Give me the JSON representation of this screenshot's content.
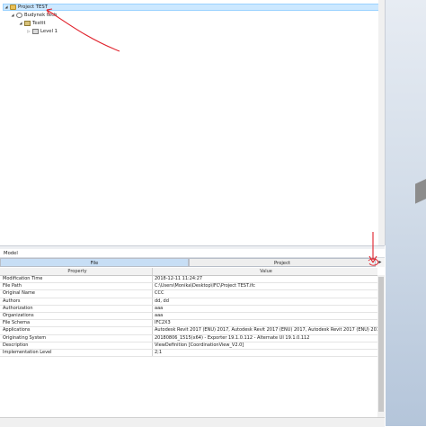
{
  "tree": {
    "items": [
      {
        "label": "Project TEST",
        "toggle": "◢",
        "icon": "folder-icon"
      },
      {
        "label": "Budynek tech",
        "toggle": "◢",
        "icon": "building-icon"
      },
      {
        "label": "Testtt",
        "toggle": "◢",
        "icon": "level-icon"
      },
      {
        "label": "Level 1",
        "toggle": "▷",
        "icon": "storey-icon"
      }
    ]
  },
  "model_panel": {
    "title": "Model",
    "tabs": [
      {
        "label": "File",
        "active": true
      },
      {
        "label": "Project",
        "active": false
      }
    ],
    "tab_arrow": "▸",
    "columns": [
      "Property",
      "Value"
    ],
    "rows": [
      {
        "property": "Modification Time",
        "value": "2018-12-11 11:24:27"
      },
      {
        "property": "File Path",
        "value": "C:\\Users\\Monika\\Desktop\\IFC\\Project TEST.ifc"
      },
      {
        "property": "Original Name",
        "value": "CCC"
      },
      {
        "property": "Authors",
        "value": "dd, dd"
      },
      {
        "property": "Authorization",
        "value": "aaa"
      },
      {
        "property": "Organizations",
        "value": "aaa"
      },
      {
        "property": "File Schema",
        "value": "IFC2X3"
      },
      {
        "property": "Applications",
        "value": "Autodesk Revit 2017 (ENU) 2017, Autodesk Revit 2017 (ENU) 2017, Autodesk Revit 2017 (ENU) 2017, Autodesk..."
      },
      {
        "property": "Originating System",
        "value": "20180806_1515(x64) - Exporter 19.1.0.112 - Alternate UI 19.1.0.112"
      },
      {
        "property": "Description",
        "value": "ViewDefinition [CoordinationView_V2.0]"
      },
      {
        "property": "Implementation Level",
        "value": "2;1"
      }
    ]
  },
  "colors": {
    "selection": "#cce8ff",
    "active_tab": "#c7def5",
    "annotation": "#e0202a"
  }
}
